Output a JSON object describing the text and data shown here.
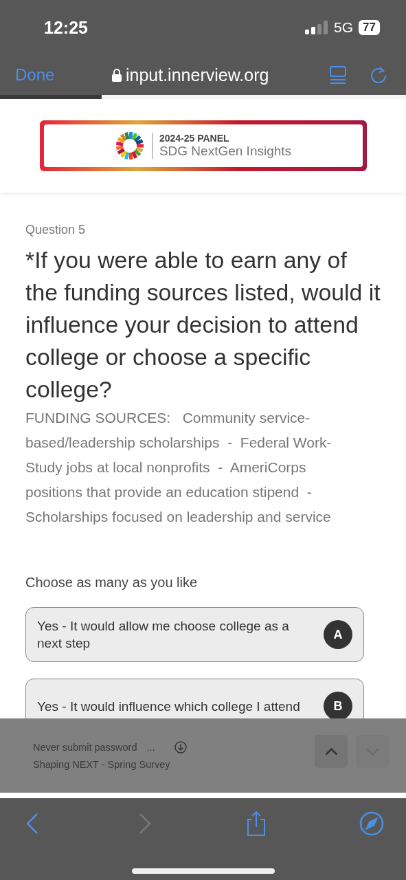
{
  "status_bar": {
    "time": "12:25",
    "network": "5G",
    "battery": "77"
  },
  "browser_bar": {
    "done": "Done",
    "url": "input.innerview.org",
    "progress": {
      "level": 0.25
    }
  },
  "banner": {
    "heading": "2024-25 **PANEL**",
    "subtitle": "SDG NextGen Insights"
  },
  "question": {
    "number": "Question 5",
    "title": "*If you were able to earn any of the funding sources listed, would it influence your decision to attend college or choose a specific college?",
    "description": "FUNDING SOURCES:   Community service-based/leadership scholarships  -  Federal Work-Study jobs at local nonprofits  -  AmeriCorps positions that provide an education stipend  -   Scholarships focused on leadership and service",
    "instruction": "Choose as many as you like",
    "options": [
      {
        "label": "Yes - It would allow me choose college as a next step",
        "letter": "A",
        "selected": false
      },
      {
        "label": "Yes - It would influence which college I attend",
        "letter": "B",
        "selected": false
      }
    ]
  },
  "form_nav": {
    "hint": "Never submit password",
    "ellipsis": "...",
    "survey": "Shaping NEXT - Spring Survey",
    "up": {
      "disabled": false
    },
    "down": {
      "disabled": true
    }
  },
  "toolbar": {
    "back": {
      "disabled": false
    },
    "forward": {
      "disabled": true
    }
  }
}
